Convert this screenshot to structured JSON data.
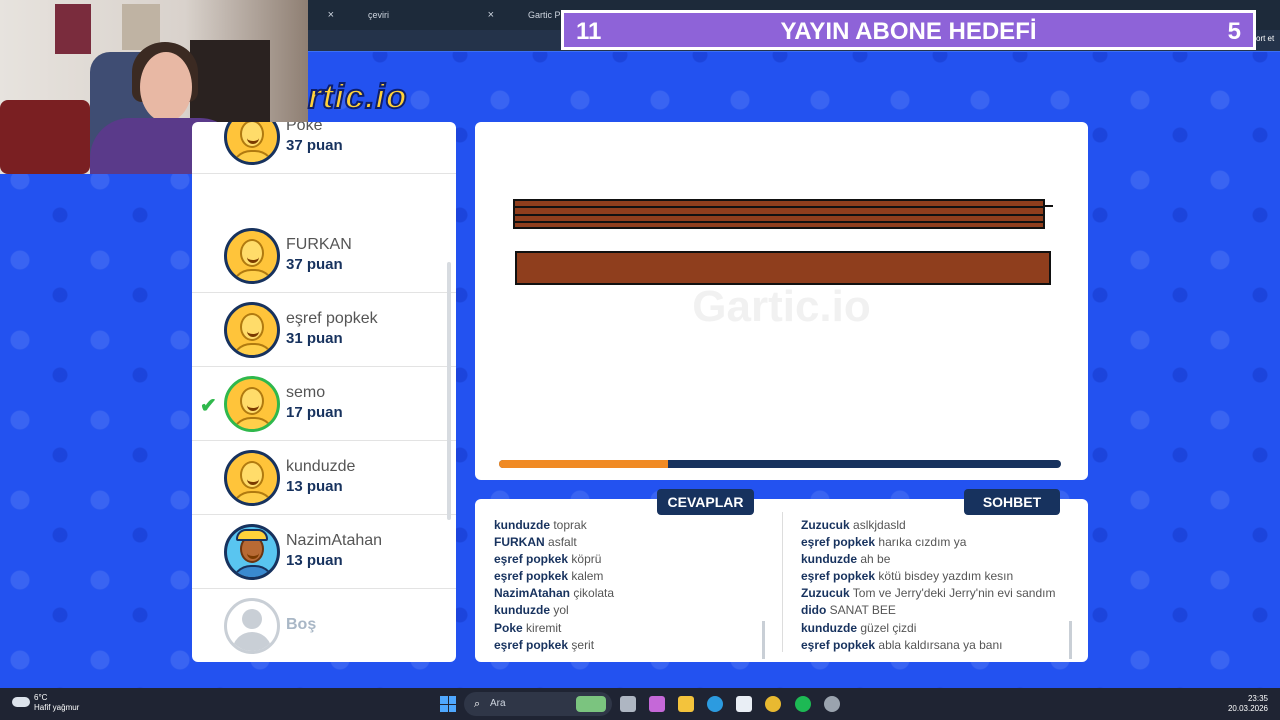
{
  "browser": {
    "tabs": [
      {
        "label": "çeviri",
        "close": "×"
      },
      {
        "label": "Gartic Ph",
        "close": "×"
      }
    ],
    "right_fragment": "ort et"
  },
  "banner": {
    "left_number": "11",
    "title": "YAYIN ABONE HEDEFİ",
    "right_number": "5"
  },
  "logo": {
    "text": "rtic.io"
  },
  "players": [
    {
      "name": "Poke",
      "score": "37 puan",
      "avatar": "smiley-yellow",
      "guessed": false
    },
    {
      "name": "FURKAN",
      "score": "37 puan",
      "avatar": "smiley-yellow",
      "guessed": false
    },
    {
      "name": "eşref popkek",
      "score": "31 puan",
      "avatar": "smiley-yellow",
      "guessed": false
    },
    {
      "name": "semo",
      "score": "17 puan",
      "avatar": "smiley-yellow",
      "guessed": true
    },
    {
      "name": "kunduzde",
      "score": "13 puan",
      "avatar": "smiley-yellow",
      "guessed": false
    },
    {
      "name": "NazimAtahan",
      "score": "13 puan",
      "avatar": "cap-boy",
      "guessed": false
    },
    {
      "name": "Boş",
      "score": "",
      "avatar": "empty",
      "guessed": false
    }
  ],
  "canvas": {
    "watermark": "Gartic.io",
    "timer_progress": 0.3,
    "colors": {
      "plank": "#8f3e1d",
      "timer_fill": "#f08a24",
      "timer_track": "#17325e"
    }
  },
  "answers": {
    "label": "CEVAPLAR",
    "items": [
      {
        "user": "kunduzde",
        "text": "toprak"
      },
      {
        "user": "FURKAN",
        "text": "asfalt"
      },
      {
        "user": "eşref popkek",
        "text": "köprü"
      },
      {
        "user": "eşref popkek",
        "text": "kalem"
      },
      {
        "user": "NazimAtahan",
        "text": "çikolata"
      },
      {
        "user": "kunduzde",
        "text": "yol"
      },
      {
        "user": "Poke",
        "text": "kiremit"
      },
      {
        "user": "eşref popkek",
        "text": "şerit"
      }
    ]
  },
  "chat": {
    "label": "SOHBET",
    "items": [
      {
        "user": "Zuzucuk",
        "text": "aslkjdasld"
      },
      {
        "user": "eşref popkek",
        "text": "harıka cızdım ya"
      },
      {
        "user": "kunduzde",
        "text": "ah be"
      },
      {
        "user": "eşref popkek",
        "text": "kötü bisdey yazdım kesın"
      },
      {
        "user": "Zuzucuk",
        "text": "Tom ve Jerry'deki Jerry'nin evi sandım"
      },
      {
        "user": "dido",
        "text": "SANAT BEE"
      },
      {
        "user": "kunduzde",
        "text": "güzel çizdi"
      },
      {
        "user": "eşref popkek",
        "text": "abla kaldırsana ya banı"
      }
    ]
  },
  "taskbar": {
    "temperature": "6°C",
    "weather": "Hafif yağmur",
    "search_placeholder": "Ara",
    "time": "23:35",
    "date": "20.03.2026"
  }
}
